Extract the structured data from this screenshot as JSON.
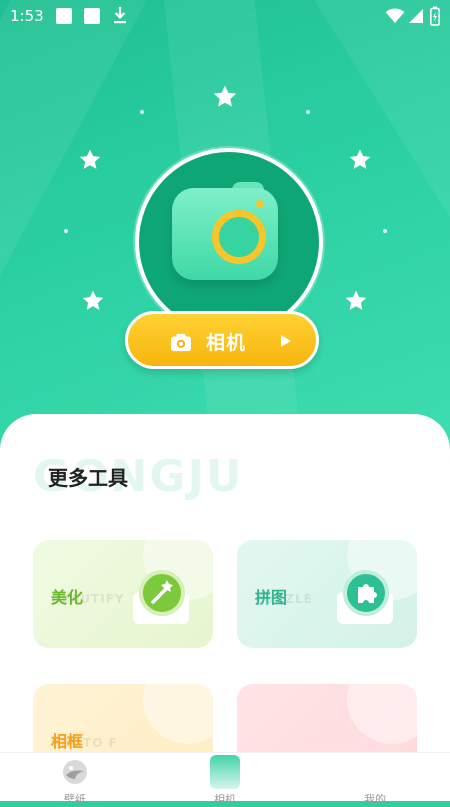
{
  "status_bar": {
    "time": "1:53"
  },
  "hero": {
    "camera_button_label": "相机"
  },
  "tools": {
    "section_title": "更多工具",
    "section_bg_text": "GONGJU",
    "cards": [
      {
        "name": "美化",
        "sub": "BEAUTIFY",
        "color": "#6ab82e"
      },
      {
        "name": "拼图",
        "sub": "PUZZLE",
        "color": "#2fb58d"
      },
      {
        "name": "相框",
        "sub": "PHOTO F",
        "color": "#f0a21b"
      }
    ]
  },
  "bottom_nav": {
    "tabs": [
      "壁纸",
      "相机",
      "我的"
    ]
  },
  "colors": {
    "brand_green": "#2bd0a2",
    "accent_yellow": "#f8c52a"
  }
}
